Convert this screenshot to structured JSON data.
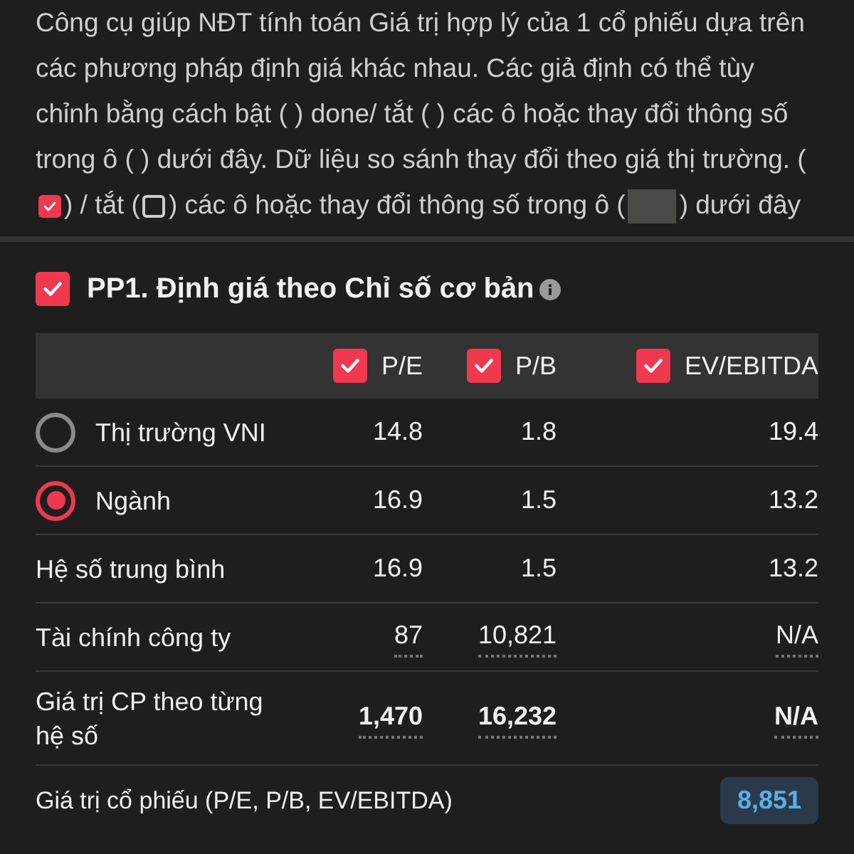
{
  "intro": [
    {
      "kind": "text",
      "text": "Công cụ giúp NĐT tính toán Giá trị hợp lý của 1 cổ phiếu dựa trên các phương pháp định giá khác nhau. Các giả định có thể tùy chỉnh bằng cách bật ( ) done/ tắt ( ) các ô hoặc thay đổi thông số trong ô ( ) dưới đây. Dữ liệu so sánh thay đổi theo giá thị trường. ("
    },
    {
      "kind": "checked_box"
    },
    {
      "kind": "text",
      "text": ") / tắt ("
    },
    {
      "kind": "empty_box"
    },
    {
      "kind": "text",
      "text": ") các ô hoặc thay đổi thông số trong ô ("
    },
    {
      "kind": "input_sample"
    },
    {
      "kind": "text",
      "text": ") dưới đây"
    }
  ],
  "section": {
    "title": "PP1. Định giá theo Chỉ số cơ bản",
    "checked": true
  },
  "table": {
    "columns": [
      {
        "label": "P/E",
        "checked": true
      },
      {
        "label": "P/B",
        "checked": true
      },
      {
        "label": "EV/EBITDA",
        "checked": true
      }
    ],
    "rows": [
      {
        "kind": "radio",
        "label": "Thị trường VNI",
        "selected": false,
        "values": [
          "14.8",
          "1.8",
          "19.4"
        ]
      },
      {
        "kind": "radio",
        "label": "Ngành",
        "selected": true,
        "values": [
          "16.9",
          "1.5",
          "13.2"
        ]
      },
      {
        "kind": "plain",
        "label": "Hệ số trung bình",
        "values": [
          "16.9",
          "1.5",
          "13.2"
        ]
      },
      {
        "kind": "editable",
        "label": "Tài chính công ty",
        "values": [
          "87",
          "10,821",
          "N/A"
        ]
      },
      {
        "kind": "result",
        "label": "Giá trị CP theo từng hệ số",
        "values": [
          "1,470",
          "16,232",
          "N/A"
        ]
      }
    ]
  },
  "summary": {
    "label": "Giá trị cổ phiếu (P/E, P/B, EV/EBITDA)",
    "value": "8,851"
  }
}
